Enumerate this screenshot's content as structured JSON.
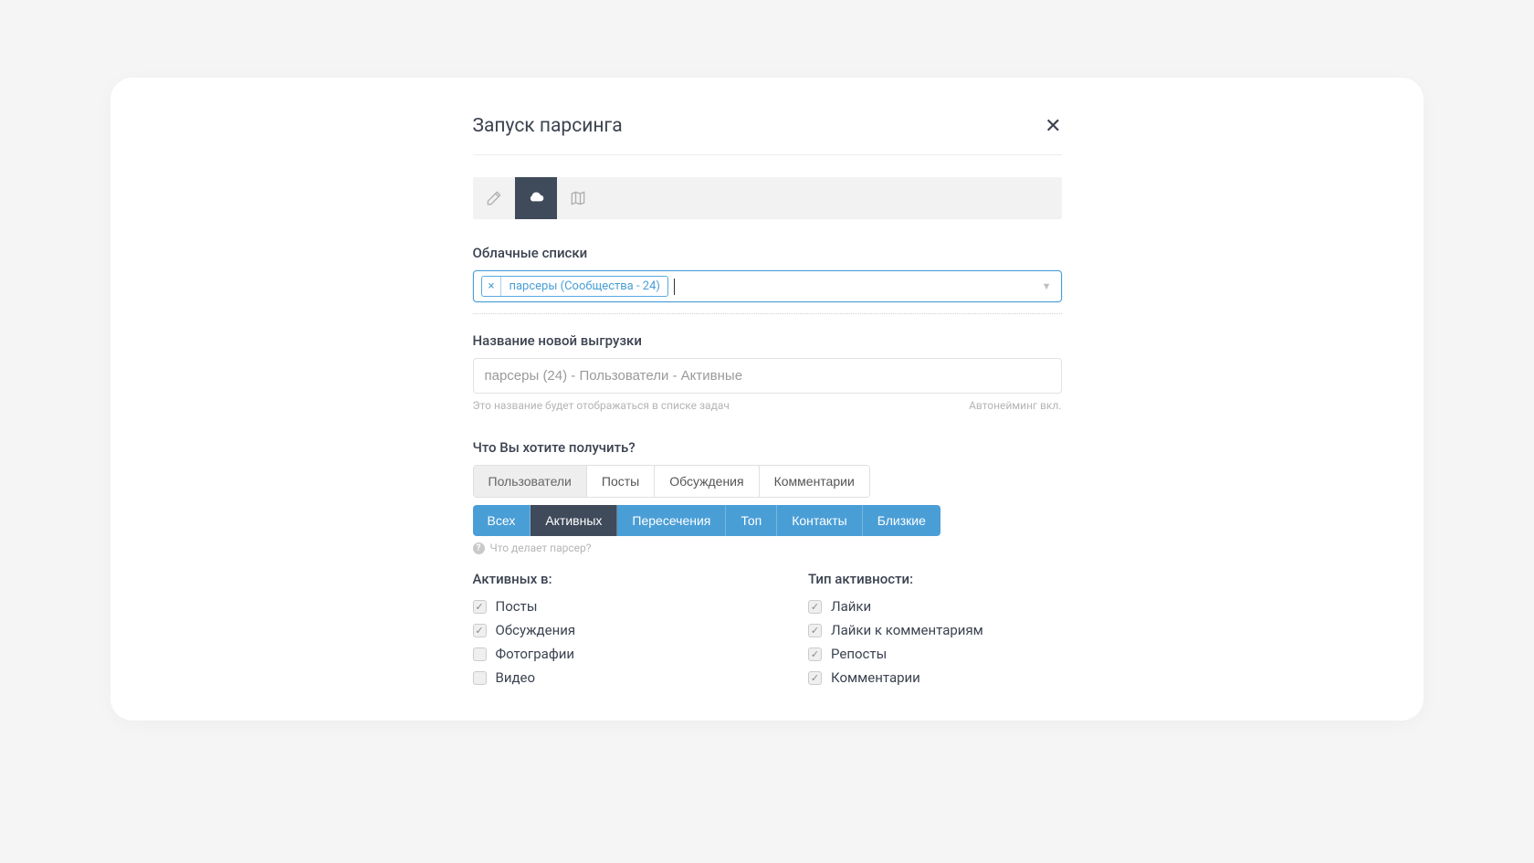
{
  "header": {
    "title": "Запуск парсинга"
  },
  "cloudLists": {
    "label": "Облачные списки",
    "chipLabel": "парсеры (Сообщества - 24)"
  },
  "exportName": {
    "label": "Название новой выгрузки",
    "value": "парсеры (24) - Пользователи - Активные",
    "helperLeft": "Это название будет отображаться в списке задач",
    "helperRight": "Автонейминг вкл."
  },
  "whatGet": {
    "label": "Что Вы хотите получить?",
    "tabs": [
      "Пользователи",
      "Посты",
      "Обсуждения",
      "Комментарии"
    ]
  },
  "filterTabs": [
    "Всех",
    "Активных",
    "Пересечения",
    "Топ",
    "Контакты",
    "Близкие"
  ],
  "hint": "Что делает парсер?",
  "activeIn": {
    "title": "Активных в:",
    "items": [
      {
        "label": "Посты",
        "checked": true
      },
      {
        "label": "Обсуждения",
        "checked": true
      },
      {
        "label": "Фотографии",
        "checked": false
      },
      {
        "label": "Видео",
        "checked": false
      }
    ]
  },
  "activityType": {
    "title": "Тип активности:",
    "items": [
      {
        "label": "Лайки",
        "checked": true
      },
      {
        "label": "Лайки к комментариям",
        "checked": true
      },
      {
        "label": "Репосты",
        "checked": true
      },
      {
        "label": "Комментарии",
        "checked": true
      }
    ]
  }
}
